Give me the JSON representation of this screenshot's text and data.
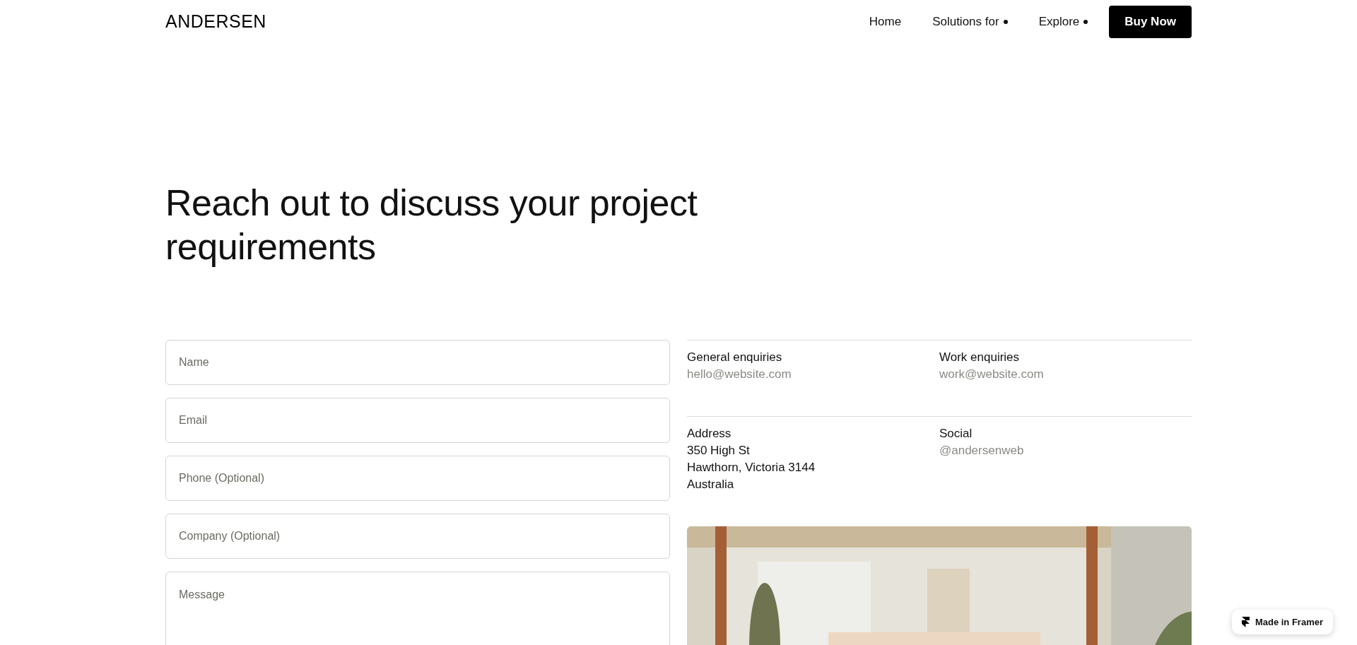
{
  "brand": {
    "name": "ANDERSEN"
  },
  "nav": {
    "items": [
      {
        "label": "Home",
        "has_menu": false
      },
      {
        "label": "Solutions for",
        "has_menu": true
      },
      {
        "label": "Explore",
        "has_menu": true
      }
    ],
    "cta": "Buy Now"
  },
  "heading": "Reach out to discuss your project requirements",
  "form": {
    "fields": [
      {
        "placeholder": "Name",
        "kind": "input"
      },
      {
        "placeholder": "Email",
        "kind": "input"
      },
      {
        "placeholder": "Phone (Optional)",
        "kind": "input"
      },
      {
        "placeholder": "Company (Optional)",
        "kind": "input"
      },
      {
        "placeholder": "Message",
        "kind": "textarea"
      }
    ]
  },
  "contact": {
    "rows": [
      [
        {
          "label": "General enquiries",
          "lines": [
            {
              "text": "hello@website.com",
              "kind": "link"
            }
          ]
        },
        {
          "label": "Work enquiries",
          "lines": [
            {
              "text": "work@website.com",
              "kind": "link"
            }
          ]
        }
      ],
      [
        {
          "label": "Address",
          "lines": [
            {
              "text": "350 High St",
              "kind": "plain"
            },
            {
              "text": "Hawthorn, Victoria 3144",
              "kind": "plain"
            },
            {
              "text": "Australia",
              "kind": "plain"
            }
          ]
        },
        {
          "label": "Social",
          "lines": [
            {
              "text": "@andersenweb",
              "kind": "link"
            }
          ]
        }
      ]
    ]
  },
  "badge": {
    "label": "Made in Framer"
  }
}
